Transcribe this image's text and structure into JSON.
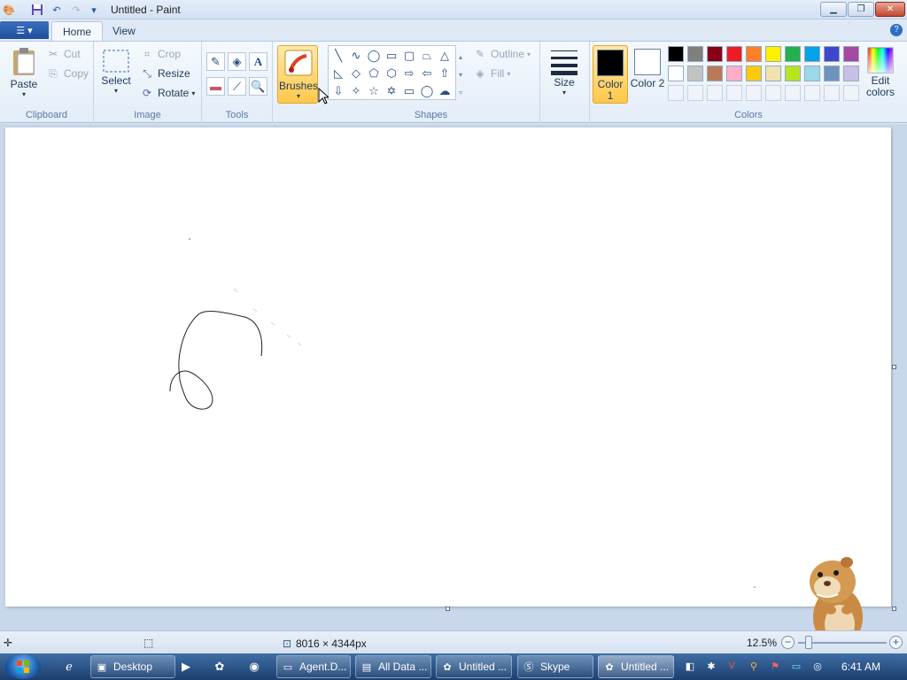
{
  "window": {
    "title": "Untitled - Paint"
  },
  "tabs": {
    "home": "Home",
    "view": "View"
  },
  "clipboard": {
    "label": "Clipboard",
    "paste": "Paste",
    "cut": "Cut",
    "copy": "Copy"
  },
  "image": {
    "label": "Image",
    "select": "Select",
    "crop": "Crop",
    "resize": "Resize",
    "rotate": "Rotate"
  },
  "tools": {
    "label": "Tools"
  },
  "brushes": {
    "label": "Brushes"
  },
  "shapes": {
    "label": "Shapes",
    "outline": "Outline",
    "fill": "Fill"
  },
  "size": {
    "label": "Size"
  },
  "colors": {
    "label": "Colors",
    "color1": "Color 1",
    "color2": "Color 2",
    "edit": "Edit colors",
    "color1_value": "#000000",
    "color2_value": "#ffffff",
    "palette_row1": [
      "#000000",
      "#7f7f7f",
      "#880015",
      "#ed1c24",
      "#ff7f27",
      "#fff200",
      "#22b14c",
      "#00a2e8",
      "#3f48cc",
      "#a349a4"
    ],
    "palette_row2": [
      "#ffffff",
      "#c3c3c3",
      "#b97a57",
      "#ffaec9",
      "#ffc90e",
      "#efe4b0",
      "#b5e61d",
      "#99d9ea",
      "#7092be",
      "#c8bfe7"
    ]
  },
  "status": {
    "dimensions": "8016 × 4344px",
    "zoom": "12.5%"
  },
  "taskbar": {
    "items": [
      "Desktop",
      "Agent.D...",
      "All Data ...",
      "Untitled ...",
      "Skype",
      "Untitled ..."
    ],
    "clock": "6:41 AM"
  }
}
